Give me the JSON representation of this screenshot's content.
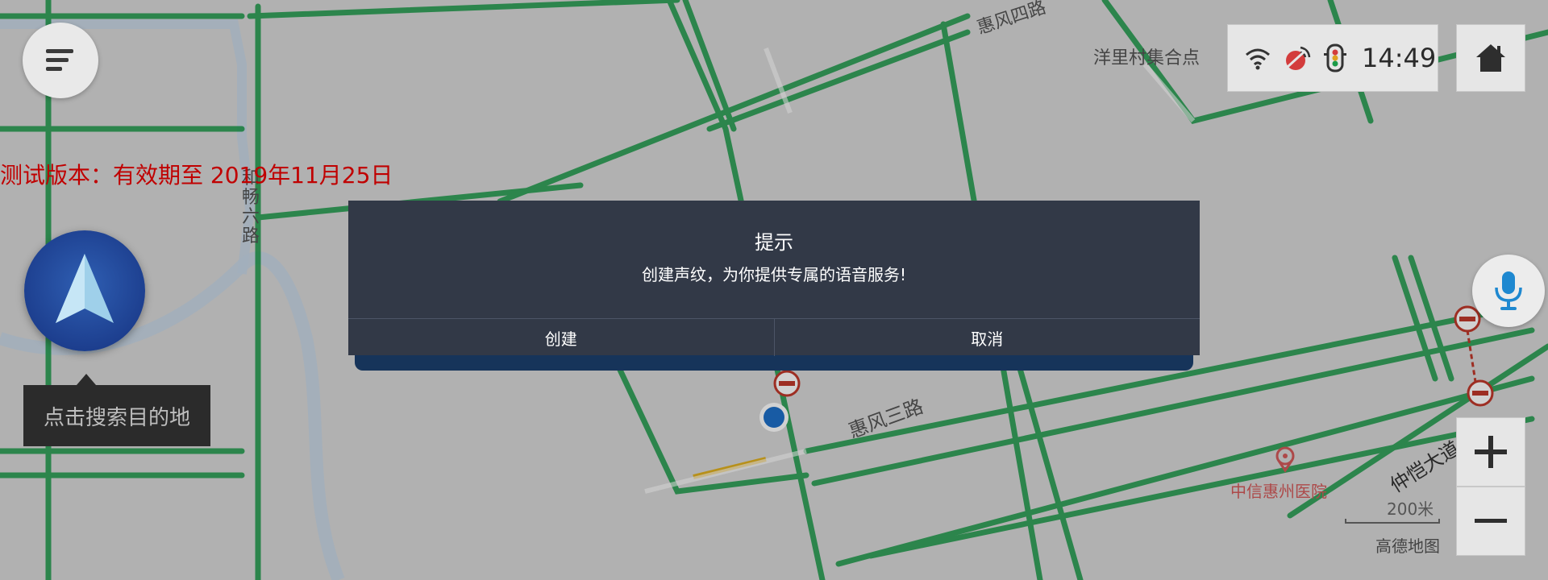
{
  "map": {
    "labels": {
      "road_huifeng4": "惠风四路",
      "road_huifeng3": "惠风三路",
      "road_he6": "和畅六路",
      "road_zhongkai": "仲恺大道",
      "poi_yangli": "洋里村集合点",
      "poi_hospital": "中信惠州医院"
    },
    "scale_label": "200米",
    "brand": "高德地图"
  },
  "test_version_notice": "测试版本：有效期至 2019年11月25日",
  "search_tooltip": "点击搜索目的地",
  "status": {
    "time": "14:49",
    "icons": [
      "wifi-icon",
      "gps-signal-icon",
      "traffic-light-icon"
    ]
  },
  "dialog": {
    "title": "提示",
    "message": "创建声纹，为你提供专属的语音服务!",
    "confirm_label": "创建",
    "cancel_label": "取消"
  },
  "colors": {
    "road_green": "#1a9a48",
    "dialog_bg": "#323947",
    "test_notice_red": "#c00000",
    "nav_blue": "#1d3f8f"
  }
}
